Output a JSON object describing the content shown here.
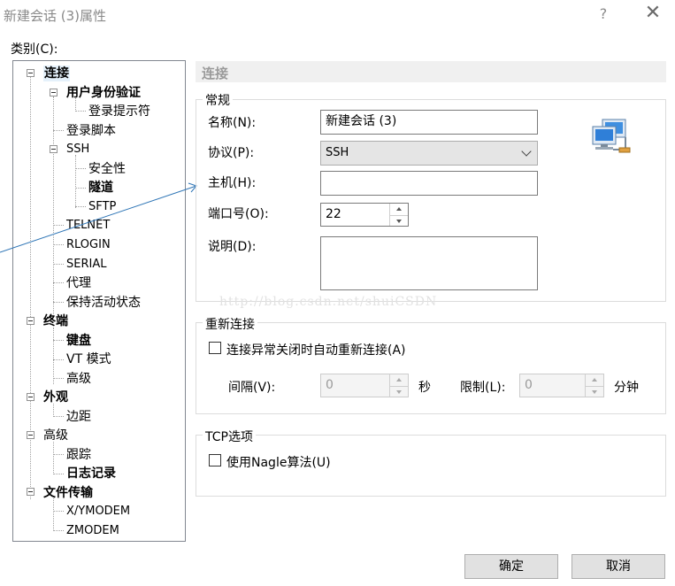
{
  "window": {
    "title": "新建会话 (3)属性",
    "help": "?",
    "close": "✕"
  },
  "category_label": "类别(C):",
  "tree": {
    "connection": "连接",
    "auth": "用户身份验证",
    "login_prompt": "登录提示符",
    "login_script": "登录脚本",
    "ssh": "SSH",
    "security": "安全性",
    "tunnel": "隧道",
    "sftp": "SFTP",
    "telnet": "TELNET",
    "rlogin": "RLOGIN",
    "serial": "SERIAL",
    "proxy": "代理",
    "keepalive": "保持活动状态",
    "terminal": "终端",
    "keyboard": "键盘",
    "vt_mode": "VT 模式",
    "advanced": "高级",
    "appearance": "外观",
    "margin": "边距",
    "advanced2": "高级",
    "trace": "跟踪",
    "logging": "日志记录",
    "file_transfer": "文件传输",
    "xymodem": "X/YMODEM",
    "zmodem": "ZMODEM"
  },
  "panel": {
    "header": "连接",
    "general": {
      "title": "常规",
      "name_label": "名称(N):",
      "name_value": "新建会话 (3)",
      "protocol_label": "协议(P):",
      "protocol_value": "SSH",
      "host_label": "主机(H):",
      "host_value": "",
      "port_label": "端口号(O):",
      "port_value": "22",
      "desc_label": "说明(D):",
      "desc_value": ""
    },
    "reconnect": {
      "title": "重新连接",
      "checkbox_label": "连接异常关闭时自动重新连接(A)",
      "checked": false,
      "interval_label": "间隔(V):",
      "interval_value": "0",
      "interval_unit": "秒",
      "limit_label": "限制(L):",
      "limit_value": "0",
      "limit_unit": "分钟"
    },
    "tcp": {
      "title": "TCP选项",
      "nagle_label": "使用Nagle算法(U)",
      "checked": false
    }
  },
  "watermark": "http://blog.csdn.net/shuiCSDN",
  "buttons": {
    "ok": "确定",
    "cancel": "取消"
  },
  "colors": {
    "arrow": "#2e75b6",
    "header_bg": "#f0f0f0"
  },
  "icons": {
    "session": "network-computers-icon"
  }
}
